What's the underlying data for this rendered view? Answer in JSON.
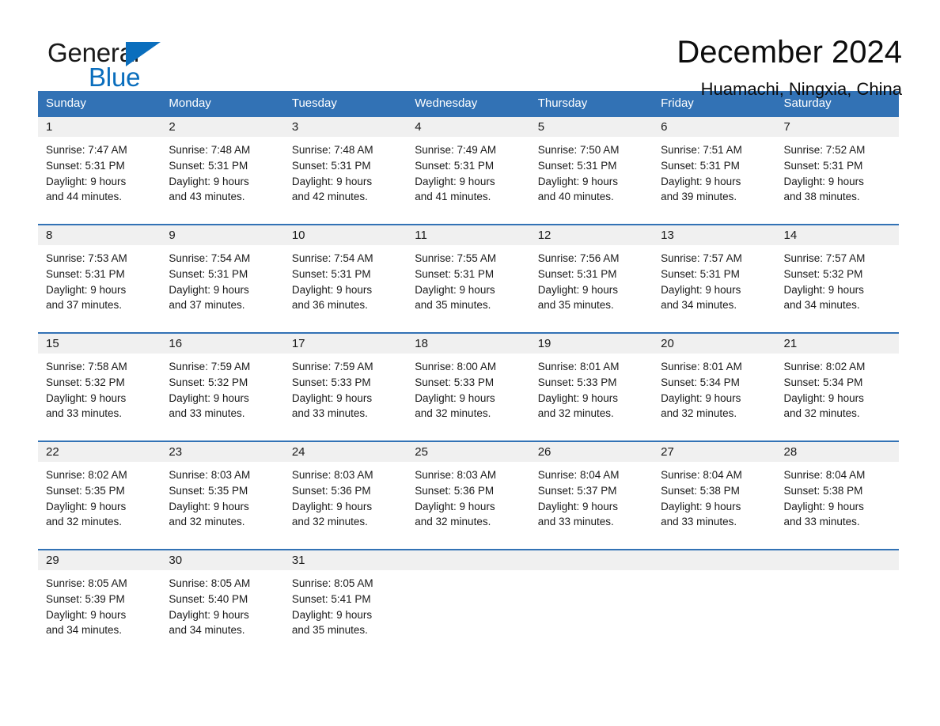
{
  "brand": {
    "name_part1": "General",
    "name_part2": "Blue",
    "logo_icon": "triangle-logo-icon",
    "accent_color": "#0a6ebd"
  },
  "header": {
    "title": "December 2024",
    "location": "Huamachi, Ningxia, China"
  },
  "calendar": {
    "header_bg": "#3272b5",
    "daynum_bg": "#f0f0f0",
    "weekday_headers": [
      "Sunday",
      "Monday",
      "Tuesday",
      "Wednesday",
      "Thursday",
      "Friday",
      "Saturday"
    ],
    "weeks": [
      [
        {
          "day": "1",
          "sunrise": "Sunrise: 7:47 AM",
          "sunset": "Sunset: 5:31 PM",
          "daylight_1": "Daylight: 9 hours",
          "daylight_2": "and 44 minutes."
        },
        {
          "day": "2",
          "sunrise": "Sunrise: 7:48 AM",
          "sunset": "Sunset: 5:31 PM",
          "daylight_1": "Daylight: 9 hours",
          "daylight_2": "and 43 minutes."
        },
        {
          "day": "3",
          "sunrise": "Sunrise: 7:48 AM",
          "sunset": "Sunset: 5:31 PM",
          "daylight_1": "Daylight: 9 hours",
          "daylight_2": "and 42 minutes."
        },
        {
          "day": "4",
          "sunrise": "Sunrise: 7:49 AM",
          "sunset": "Sunset: 5:31 PM",
          "daylight_1": "Daylight: 9 hours",
          "daylight_2": "and 41 minutes."
        },
        {
          "day": "5",
          "sunrise": "Sunrise: 7:50 AM",
          "sunset": "Sunset: 5:31 PM",
          "daylight_1": "Daylight: 9 hours",
          "daylight_2": "and 40 minutes."
        },
        {
          "day": "6",
          "sunrise": "Sunrise: 7:51 AM",
          "sunset": "Sunset: 5:31 PM",
          "daylight_1": "Daylight: 9 hours",
          "daylight_2": "and 39 minutes."
        },
        {
          "day": "7",
          "sunrise": "Sunrise: 7:52 AM",
          "sunset": "Sunset: 5:31 PM",
          "daylight_1": "Daylight: 9 hours",
          "daylight_2": "and 38 minutes."
        }
      ],
      [
        {
          "day": "8",
          "sunrise": "Sunrise: 7:53 AM",
          "sunset": "Sunset: 5:31 PM",
          "daylight_1": "Daylight: 9 hours",
          "daylight_2": "and 37 minutes."
        },
        {
          "day": "9",
          "sunrise": "Sunrise: 7:54 AM",
          "sunset": "Sunset: 5:31 PM",
          "daylight_1": "Daylight: 9 hours",
          "daylight_2": "and 37 minutes."
        },
        {
          "day": "10",
          "sunrise": "Sunrise: 7:54 AM",
          "sunset": "Sunset: 5:31 PM",
          "daylight_1": "Daylight: 9 hours",
          "daylight_2": "and 36 minutes."
        },
        {
          "day": "11",
          "sunrise": "Sunrise: 7:55 AM",
          "sunset": "Sunset: 5:31 PM",
          "daylight_1": "Daylight: 9 hours",
          "daylight_2": "and 35 minutes."
        },
        {
          "day": "12",
          "sunrise": "Sunrise: 7:56 AM",
          "sunset": "Sunset: 5:31 PM",
          "daylight_1": "Daylight: 9 hours",
          "daylight_2": "and 35 minutes."
        },
        {
          "day": "13",
          "sunrise": "Sunrise: 7:57 AM",
          "sunset": "Sunset: 5:31 PM",
          "daylight_1": "Daylight: 9 hours",
          "daylight_2": "and 34 minutes."
        },
        {
          "day": "14",
          "sunrise": "Sunrise: 7:57 AM",
          "sunset": "Sunset: 5:32 PM",
          "daylight_1": "Daylight: 9 hours",
          "daylight_2": "and 34 minutes."
        }
      ],
      [
        {
          "day": "15",
          "sunrise": "Sunrise: 7:58 AM",
          "sunset": "Sunset: 5:32 PM",
          "daylight_1": "Daylight: 9 hours",
          "daylight_2": "and 33 minutes."
        },
        {
          "day": "16",
          "sunrise": "Sunrise: 7:59 AM",
          "sunset": "Sunset: 5:32 PM",
          "daylight_1": "Daylight: 9 hours",
          "daylight_2": "and 33 minutes."
        },
        {
          "day": "17",
          "sunrise": "Sunrise: 7:59 AM",
          "sunset": "Sunset: 5:33 PM",
          "daylight_1": "Daylight: 9 hours",
          "daylight_2": "and 33 minutes."
        },
        {
          "day": "18",
          "sunrise": "Sunrise: 8:00 AM",
          "sunset": "Sunset: 5:33 PM",
          "daylight_1": "Daylight: 9 hours",
          "daylight_2": "and 32 minutes."
        },
        {
          "day": "19",
          "sunrise": "Sunrise: 8:01 AM",
          "sunset": "Sunset: 5:33 PM",
          "daylight_1": "Daylight: 9 hours",
          "daylight_2": "and 32 minutes."
        },
        {
          "day": "20",
          "sunrise": "Sunrise: 8:01 AM",
          "sunset": "Sunset: 5:34 PM",
          "daylight_1": "Daylight: 9 hours",
          "daylight_2": "and 32 minutes."
        },
        {
          "day": "21",
          "sunrise": "Sunrise: 8:02 AM",
          "sunset": "Sunset: 5:34 PM",
          "daylight_1": "Daylight: 9 hours",
          "daylight_2": "and 32 minutes."
        }
      ],
      [
        {
          "day": "22",
          "sunrise": "Sunrise: 8:02 AM",
          "sunset": "Sunset: 5:35 PM",
          "daylight_1": "Daylight: 9 hours",
          "daylight_2": "and 32 minutes."
        },
        {
          "day": "23",
          "sunrise": "Sunrise: 8:03 AM",
          "sunset": "Sunset: 5:35 PM",
          "daylight_1": "Daylight: 9 hours",
          "daylight_2": "and 32 minutes."
        },
        {
          "day": "24",
          "sunrise": "Sunrise: 8:03 AM",
          "sunset": "Sunset: 5:36 PM",
          "daylight_1": "Daylight: 9 hours",
          "daylight_2": "and 32 minutes."
        },
        {
          "day": "25",
          "sunrise": "Sunrise: 8:03 AM",
          "sunset": "Sunset: 5:36 PM",
          "daylight_1": "Daylight: 9 hours",
          "daylight_2": "and 32 minutes."
        },
        {
          "day": "26",
          "sunrise": "Sunrise: 8:04 AM",
          "sunset": "Sunset: 5:37 PM",
          "daylight_1": "Daylight: 9 hours",
          "daylight_2": "and 33 minutes."
        },
        {
          "day": "27",
          "sunrise": "Sunrise: 8:04 AM",
          "sunset": "Sunset: 5:38 PM",
          "daylight_1": "Daylight: 9 hours",
          "daylight_2": "and 33 minutes."
        },
        {
          "day": "28",
          "sunrise": "Sunrise: 8:04 AM",
          "sunset": "Sunset: 5:38 PM",
          "daylight_1": "Daylight: 9 hours",
          "daylight_2": "and 33 minutes."
        }
      ],
      [
        {
          "day": "29",
          "sunrise": "Sunrise: 8:05 AM",
          "sunset": "Sunset: 5:39 PM",
          "daylight_1": "Daylight: 9 hours",
          "daylight_2": "and 34 minutes."
        },
        {
          "day": "30",
          "sunrise": "Sunrise: 8:05 AM",
          "sunset": "Sunset: 5:40 PM",
          "daylight_1": "Daylight: 9 hours",
          "daylight_2": "and 34 minutes."
        },
        {
          "day": "31",
          "sunrise": "Sunrise: 8:05 AM",
          "sunset": "Sunset: 5:41 PM",
          "daylight_1": "Daylight: 9 hours",
          "daylight_2": "and 35 minutes."
        },
        {
          "day": "",
          "sunrise": "",
          "sunset": "",
          "daylight_1": "",
          "daylight_2": ""
        },
        {
          "day": "",
          "sunrise": "",
          "sunset": "",
          "daylight_1": "",
          "daylight_2": ""
        },
        {
          "day": "",
          "sunrise": "",
          "sunset": "",
          "daylight_1": "",
          "daylight_2": ""
        },
        {
          "day": "",
          "sunrise": "",
          "sunset": "",
          "daylight_1": "",
          "daylight_2": ""
        }
      ]
    ]
  }
}
